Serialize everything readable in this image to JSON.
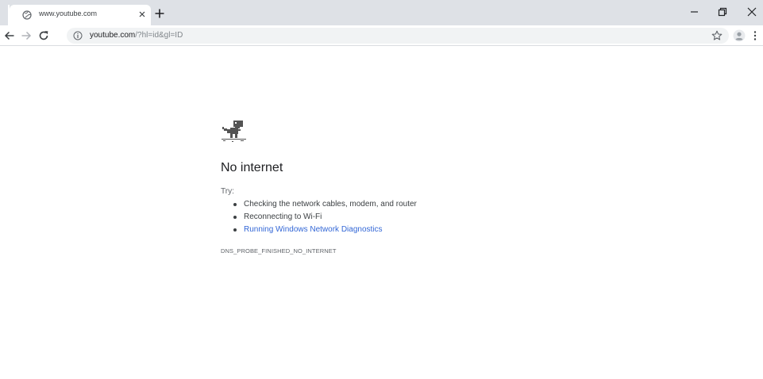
{
  "browser": {
    "tab": {
      "title": "www.youtube.com",
      "favicon": "globe-icon"
    },
    "address_bar": {
      "host": "youtube.com",
      "path": "/?hl=id&gl=ID"
    },
    "icons": {
      "back": "arrow-left-icon",
      "forward": "arrow-right-icon",
      "reload": "reload-icon",
      "info": "info-icon",
      "bookmark": "star-icon",
      "profile": "avatar-icon",
      "menu": "kebab-menu-icon"
    }
  },
  "error_page": {
    "icon": "offline-dino-icon",
    "title": "No internet",
    "try_label": "Try:",
    "suggestions": [
      "Checking the network cables, modem, and router",
      "Reconnecting to Wi-Fi",
      "Running Windows Network Diagnostics"
    ],
    "error_code": "DNS_PROBE_FINISHED_NO_INTERNET"
  },
  "colors": {
    "tabstrip_bg": "#dee1e6",
    "omnibox_bg": "#f1f3f4",
    "link": "#3367d6",
    "title_text": "#202124"
  }
}
